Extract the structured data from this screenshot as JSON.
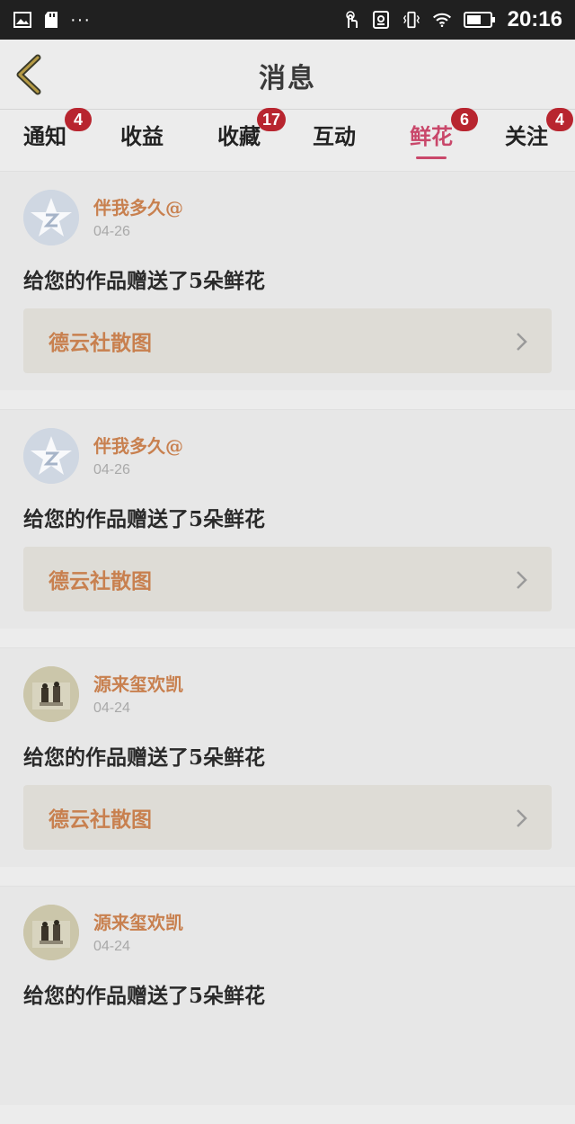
{
  "status_bar": {
    "left_icons": [
      "image-icon",
      "sd-card-icon"
    ],
    "dots": "···",
    "right_icons": [
      "touch-icon",
      "storage-icon",
      "vibrate-icon",
      "wifi-icon",
      "battery-icon"
    ],
    "time": "20:16"
  },
  "header": {
    "back_icon": "chevron-left-icon",
    "title": "消息"
  },
  "tabs": [
    {
      "label": "通知",
      "badge": "4",
      "active": false
    },
    {
      "label": "收益",
      "badge": "",
      "active": false
    },
    {
      "label": "收藏",
      "badge": "17",
      "active": false
    },
    {
      "label": "互动",
      "badge": "",
      "active": false
    },
    {
      "label": "鲜花",
      "badge": "6",
      "active": true
    },
    {
      "label": "关注",
      "badge": "4",
      "active": false
    }
  ],
  "messages": [
    {
      "user": "伴我多久@",
      "date": "04-26",
      "text": "给您的作品赠送了5朵鲜花",
      "work": "德云社散图",
      "avatar": "default-avatar-icon"
    },
    {
      "user": "伴我多久@",
      "date": "04-26",
      "text": "给您的作品赠送了5朵鲜花",
      "work": "德云社散图",
      "avatar": "default-avatar-icon"
    },
    {
      "user": "源来玺欢凯",
      "date": "04-24",
      "text": "给您的作品赠送了5朵鲜花",
      "work": "德云社散图",
      "avatar": "photo-avatar"
    },
    {
      "user": "源来玺欢凯",
      "date": "04-24",
      "text": "给您的作品赠送了5朵鲜花",
      "work": "",
      "avatar": "photo-avatar"
    }
  ],
  "colors": {
    "accent": "#c9476a",
    "badge": "#b8252f",
    "username": "#c8804f",
    "statusbar": "#202020"
  }
}
